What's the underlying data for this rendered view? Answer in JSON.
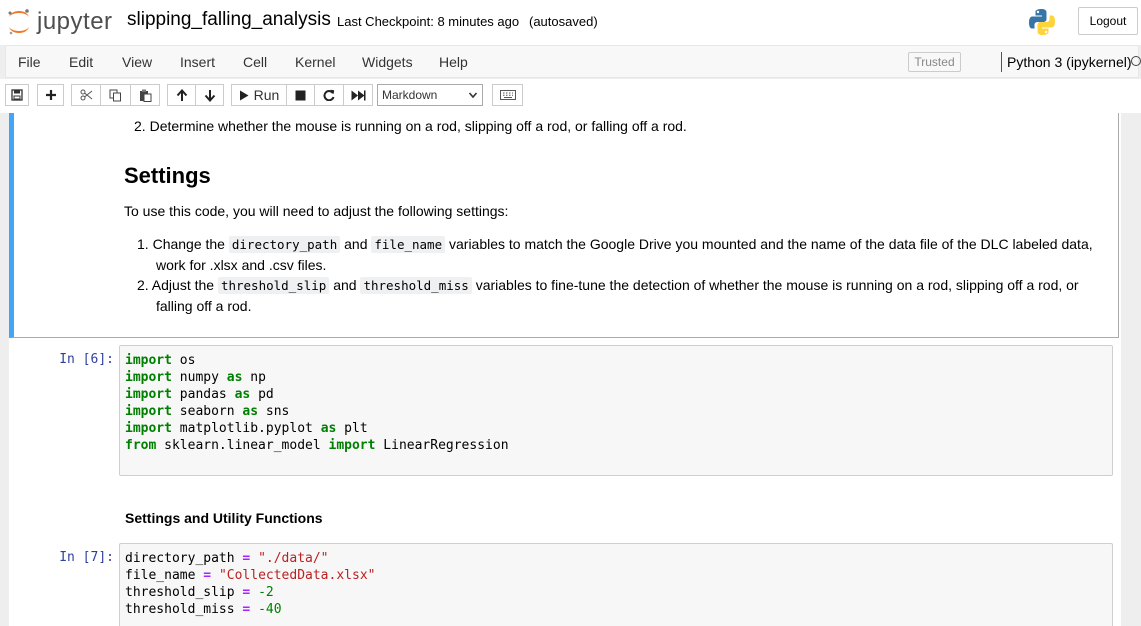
{
  "header": {
    "logo_text": "jupyter",
    "notebook_name": "slipping_falling_analysis",
    "checkpoint": "Last Checkpoint: 8 minutes ago",
    "autosave": "(autosaved)",
    "logout_label": "Logout"
  },
  "menu": {
    "items": [
      "File",
      "Edit",
      "View",
      "Insert",
      "Cell",
      "Kernel",
      "Widgets",
      "Help"
    ],
    "trusted": "Trusted",
    "kernel": "Python 3 (ipykernel)"
  },
  "toolbar": {
    "run_label": "Run",
    "cell_type": "Markdown",
    "icons": [
      "save-icon",
      "plus-icon",
      "scissors-icon",
      "copy-icon",
      "paste-icon",
      "arrow-up-icon",
      "arrow-down-icon",
      "run-icon",
      "stop-icon",
      "restart-icon",
      "fast-forward-icon",
      "keyboard-icon"
    ]
  },
  "markdown_cell": {
    "intro_item_2": "Determine whether the mouse is running on a rod, slipping off a rod, or falling off a rod.",
    "heading": "Settings",
    "paragraph": "To use this code, you will need to adjust the following settings:",
    "setting1": {
      "pre": "Change the ",
      "code1": "directory_path",
      "mid": " and ",
      "code2": "file_name",
      "post": " variables to match the Google Drive you mounted and the name of the data file of the DLC labeled data,",
      "line2": "work for .xlsx and .csv files."
    },
    "setting2": {
      "pre": "Adjust the ",
      "code1": "threshold_slip",
      "mid": " and ",
      "code2": "threshold_miss",
      "post": " variables to fine-tune the detection of whether the mouse is running on a rod, slipping off a rod, or",
      "line2": "falling off a rod."
    }
  },
  "code_cell_1": {
    "prompt": "In [6]:",
    "lines": [
      {
        "kw": "import",
        "rest": " os"
      },
      {
        "kw": "import",
        "rest": " numpy ",
        "as": "as",
        "alias": " np"
      },
      {
        "kw": "import",
        "rest": " pandas ",
        "as": "as",
        "alias": " pd"
      },
      {
        "kw": "import",
        "rest": " seaborn ",
        "as": "as",
        "alias": " sns"
      },
      {
        "kw": "import",
        "rest": " matplotlib.pyplot ",
        "as": "as",
        "alias": " plt"
      },
      {
        "kw": "from",
        "rest": " sklearn.linear_model ",
        "kw2": "import",
        "alias": " LinearRegression"
      }
    ]
  },
  "subheading": "Settings and Utility Functions",
  "code_cell_2": {
    "prompt": "In [7]:",
    "lines": [
      {
        "name": "directory_path",
        "op": "=",
        "value": "\"./data/\"",
        "type": "str"
      },
      {
        "name": "file_name",
        "op": "=",
        "value": "\"CollectedData.xlsx\"",
        "type": "str"
      },
      {
        "name": "threshold_slip",
        "op": "=",
        "value": "-2",
        "type": "num"
      },
      {
        "name": "threshold_miss",
        "op": "=",
        "value": "-40",
        "type": "num"
      }
    ]
  },
  "colors": {
    "accent": "#42a5f5",
    "prompt": "#303f9f",
    "keyword": "#008000",
    "string": "#ba2121",
    "operator": "#aa22ff"
  }
}
